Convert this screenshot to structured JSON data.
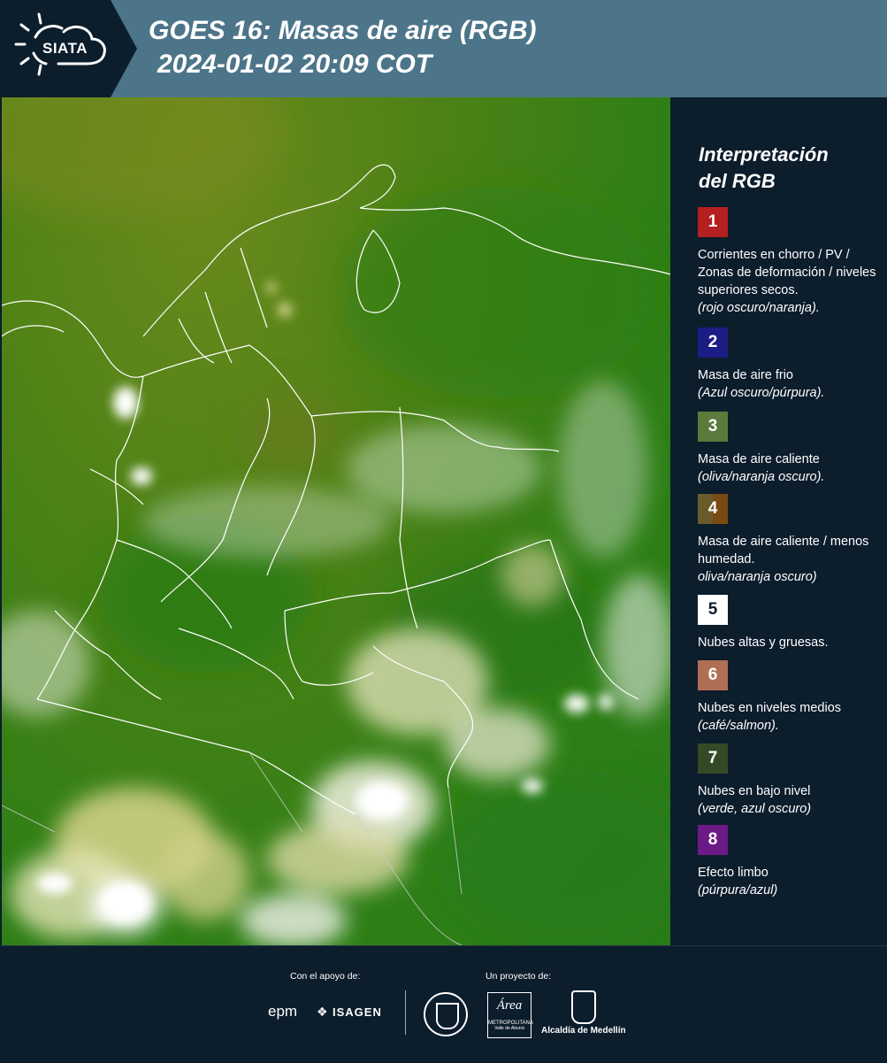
{
  "header": {
    "logo_text": "SIATA",
    "title_line1": "GOES 16: Masas de aire (RGB)",
    "title_line2": "2024-01-02 20:09 COT"
  },
  "legend": {
    "title_line1": "Interpretación",
    "title_line2": "del RGB",
    "items": [
      {
        "num": "1",
        "color": "#b3201f",
        "text": "Corrientes en chorro / PV / Zonas de deformación / niveles superiores secos.",
        "note": "(rojo oscuro/naranja)."
      },
      {
        "num": "2",
        "color": "#1b1d85",
        "text": "Masa de aire frio",
        "note": "(Azul oscuro/púrpura)."
      },
      {
        "num": "3",
        "color": "#5a7b3b",
        "text": "Masa de aire caliente",
        "note": "(oliva/naranja oscuro)."
      },
      {
        "num": "4",
        "color": "#6b5a2a",
        "color2": "#7a4a12",
        "text": "Masa de aire caliente / menos humedad.",
        "note": "oliva/naranja oscuro)"
      },
      {
        "num": "5",
        "color": "#ffffff",
        "text": "Nubes altas y gruesas.",
        "note": ""
      },
      {
        "num": "6",
        "color": "#b06f55",
        "text": "Nubes en niveles medios",
        "note": "(café/salmon)."
      },
      {
        "num": "7",
        "color": "#344a26",
        "text": "Nubes en bajo nivel",
        "note": "(verde, azul oscuro)"
      },
      {
        "num": "8",
        "color": "#6c1a86",
        "text": "Efecto limbo",
        "note": "(púrpura/azul)"
      }
    ]
  },
  "footer": {
    "support_label": "Con el apoyo de:",
    "project_label": "Un proyecto de:",
    "epm": "epm",
    "isagen": "ISAGEN",
    "metro_line1": "Área",
    "metro_line2": "METROPOLITANA",
    "metro_line3": "Valle de Aburrá",
    "alcaldia": "Alcaldía de Medellín"
  },
  "colors": {
    "background": "#0c1d2c",
    "header_bar": "#4d7589"
  }
}
